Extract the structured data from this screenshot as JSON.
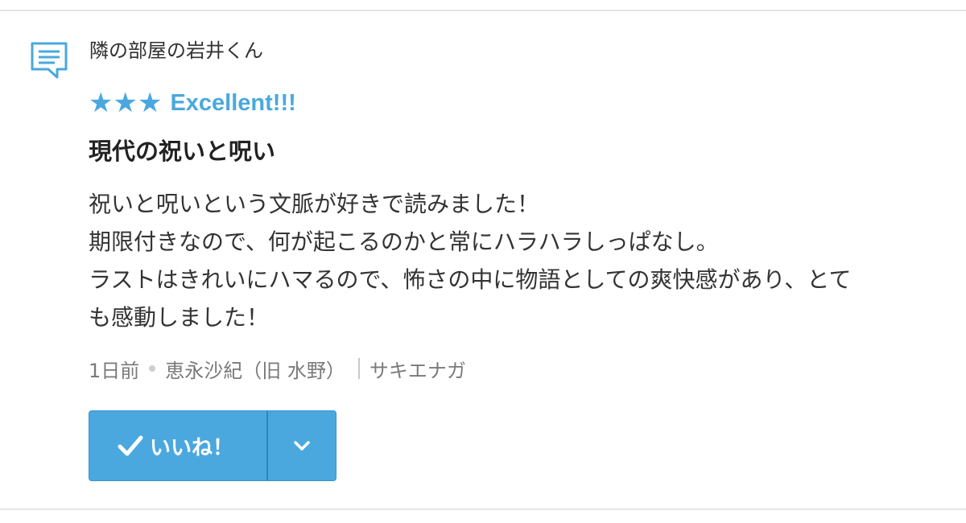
{
  "review": {
    "reviewer_name": "隣の部屋の岩井くん",
    "rating": {
      "stars": "★★★",
      "star_count": 3,
      "label": "Excellent!!!"
    },
    "title": "現代の祝いと呪い",
    "body_lines": [
      "祝いと呪いという文脈が好きで読みました！",
      "期限付きなので、何が起こるのかと常にハラハラしっぱなし。",
      "ラストはきれいにハマるので、怖さの中に物語としての爽快感があり、とて",
      "も感動しました！"
    ],
    "meta": {
      "time_ago": "1日前",
      "author": "恵永沙紀（旧 水野）",
      "author_reading": "サキエナガ"
    }
  },
  "actions": {
    "like_label": "いいね！"
  },
  "colors": {
    "accent": "#4aa8de",
    "text": "#333333",
    "muted": "#7a7a7a",
    "divider": "#e6e6e6"
  },
  "icons": {
    "comment": "comment-icon",
    "check": "check-icon",
    "dropdown": "chevron-down-icon"
  }
}
